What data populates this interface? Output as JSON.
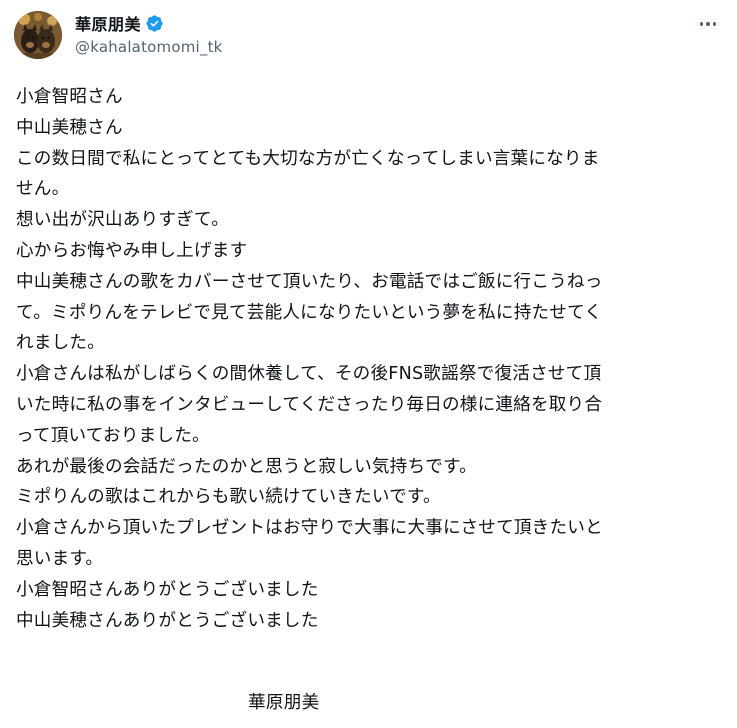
{
  "author": {
    "display_name": "華原朋美",
    "handle": "@kahalatomomi_tk",
    "verified": true,
    "verified_color": "#1d9bf0"
  },
  "icons": {
    "verified": "verified-badge-icon",
    "more": "more-options-icon"
  },
  "post": {
    "lines": [
      "小倉智昭さん",
      "中山美穂さん",
      "この数日間で私にとってとても大切な方が亡くなってしまい言葉になりま",
      "せん。",
      "想い出が沢山ありすぎて。",
      "心からお悔やみ申し上げます",
      "中山美穂さんの歌をカバーさせて頂いたり、お電話ではご飯に行こうねっ",
      "て。ミポりんをテレビで見て芸能人になりたいという夢を私に持たせてく",
      "れました。",
      "小倉さんは私がしばらくの間休養して、その後FNS歌謡祭で復活させて頂",
      "いた時に私の事をインタビューしてくださったり毎日の様に連絡を取り合",
      "って頂いておりました。",
      "あれが最後の会話だったのかと思うと寂しい気持ちです。",
      "ミポりんの歌はこれからも歌い続けていきたいです。",
      "小倉さんから頂いたプレゼントはお守りで大事に大事にさせて頂きたいと",
      "思います。",
      "小倉智昭さんありがとうございました",
      "中山美穂さんありがとうございました"
    ],
    "signature": "華原朋美"
  }
}
